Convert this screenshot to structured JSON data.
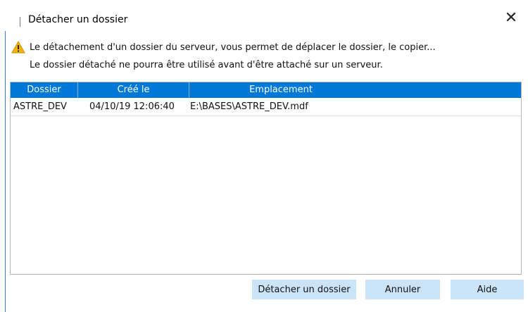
{
  "dialog": {
    "title": "Détacher un dossier",
    "close_glyph": "✕"
  },
  "message": {
    "icon": "warning-icon",
    "line1": "Le détachement d'un dossier du serveur, vous permet de déplacer le dossier, le copier...",
    "line2": "Le dossier détaché ne pourra être utilisé avant d'être attaché sur un serveur."
  },
  "table": {
    "columns": [
      "Dossier",
      "Créé le",
      "Emplacement"
    ],
    "rows": [
      [
        "ASTRE_DEV",
        "04/10/19 12:06:40",
        "E:\\BASES\\ASTRE_DEV.mdf"
      ]
    ]
  },
  "buttons": {
    "detach": "Détacher un dossier",
    "cancel": "Annuler",
    "help": "Aide"
  },
  "colors": {
    "accent": "#0078d7",
    "button_bg": "#cce4f7",
    "warning": "#f2b705"
  }
}
